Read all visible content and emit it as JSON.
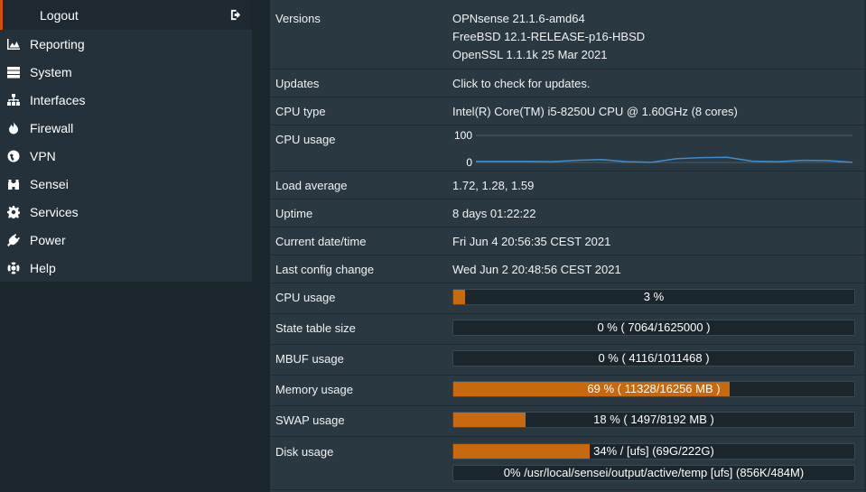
{
  "sidebar": {
    "logout": "Logout",
    "items": [
      {
        "label": "Reporting",
        "icon": "area-chart-icon"
      },
      {
        "label": "System",
        "icon": "server-icon"
      },
      {
        "label": "Interfaces",
        "icon": "sitemap-icon"
      },
      {
        "label": "Firewall",
        "icon": "fire-icon"
      },
      {
        "label": "VPN",
        "icon": "globe-icon"
      },
      {
        "label": "Sensei",
        "icon": "binoculars-icon"
      },
      {
        "label": "Services",
        "icon": "cog-icon"
      },
      {
        "label": "Power",
        "icon": "plug-icon"
      },
      {
        "label": "Help",
        "icon": "life-ring-icon"
      }
    ]
  },
  "system": {
    "versions_label": "Versions",
    "versions": [
      "OPNsense 21.1.6-amd64",
      "FreeBSD 12.1-RELEASE-p16-HBSD",
      "OpenSSL 1.1.1k 25 Mar 2021"
    ],
    "updates_label": "Updates",
    "updates_link": "Click to check for updates.",
    "cpu_type_label": "CPU type",
    "cpu_type": "Intel(R) Core(TM) i5-8250U CPU @ 1.60GHz (8 cores)",
    "cpu_graph_label": "CPU usage",
    "load_label": "Load average",
    "load": "1.72, 1.28, 1.59",
    "uptime_label": "Uptime",
    "uptime": "8 days 01:22:22",
    "datetime_label": "Current date/time",
    "datetime": "Fri Jun 4 20:56:35 CEST 2021",
    "lastconfig_label": "Last config change",
    "lastconfig": "Wed Jun 2 20:48:56 CEST 2021",
    "cpu_usage_label": "CPU usage",
    "cpu_usage_text": "3 %",
    "cpu_usage_pct": 3,
    "state_label": "State table size",
    "state_text": "0 % ( 7064/1625000 )",
    "state_pct": 0,
    "mbuf_label": "MBUF usage",
    "mbuf_text": "0 % ( 4116/1011468 )",
    "mbuf_pct": 0,
    "memory_label": "Memory usage",
    "memory_text": "69 % ( 11328/16256 MB )",
    "memory_pct": 69,
    "swap_label": "SWAP usage",
    "swap_text": "18 % ( 1497/8192 MB )",
    "swap_pct": 18,
    "disk_label": "Disk usage",
    "disk1_text": "34% / [ufs] (69G/222G)",
    "disk1_pct": 34,
    "disk2_text": "0% /usr/local/sensei/output/active/temp [ufs] (856K/484M)",
    "disk2_pct": 0
  },
  "chart_data": {
    "type": "line",
    "ylim": [
      0,
      100
    ],
    "yticks": [
      "100",
      "0"
    ],
    "line_color": "#3b8fd1",
    "values": [
      4,
      4,
      4,
      3,
      8,
      11,
      3,
      1,
      14,
      18,
      19,
      5,
      3,
      8,
      7,
      1
    ]
  }
}
